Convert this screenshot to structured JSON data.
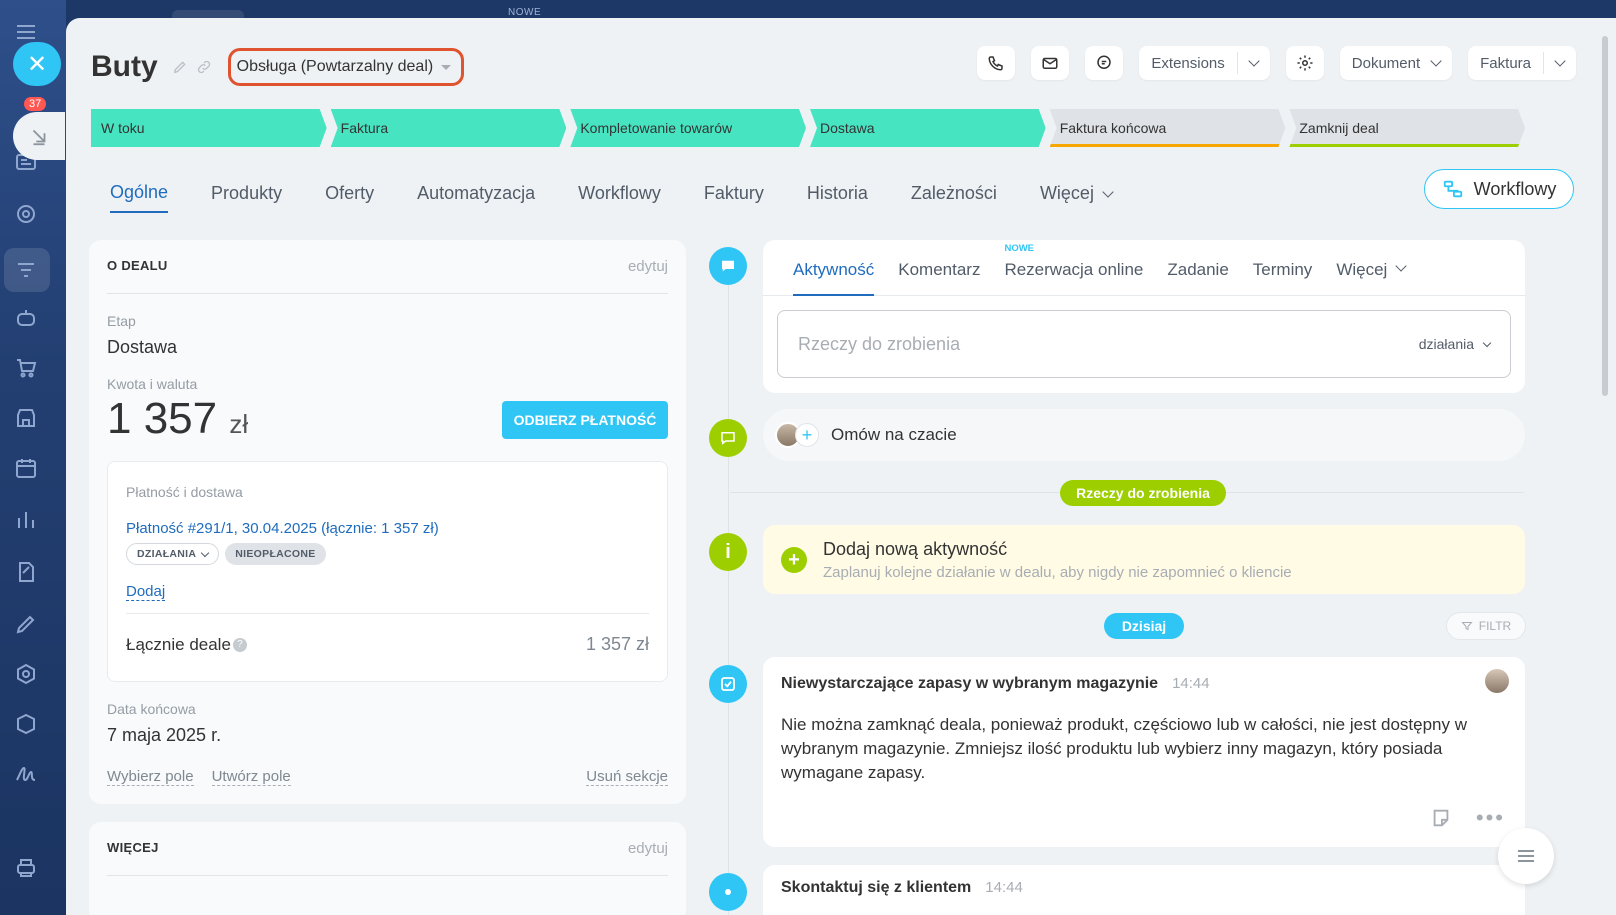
{
  "topbar": {
    "new_label": "NOWE"
  },
  "sidebar": {
    "badge_count": "37"
  },
  "deal": {
    "title": "Buty",
    "category": "Obsługa (Powtarzalny deal)"
  },
  "toolbar": {
    "extensions": "Extensions",
    "document": "Dokument",
    "invoice": "Faktura"
  },
  "stages": [
    {
      "label": "W toku",
      "state": "done"
    },
    {
      "label": "Faktura",
      "state": "done"
    },
    {
      "label": "Kompletowanie towarów",
      "state": "done"
    },
    {
      "label": "Dostawa",
      "state": "done"
    },
    {
      "label": "Faktura końcowa",
      "state": "todo"
    },
    {
      "label": "Zamknij deal",
      "state": "todo"
    }
  ],
  "tabs": [
    "Ogólne",
    "Produkty",
    "Oferty",
    "Automatyzacja",
    "Workflowy",
    "Faktury",
    "Historia",
    "Zależności",
    "Więcej"
  ],
  "workflow_button": "Workflowy",
  "about": {
    "heading": "O DEALU",
    "edit": "edytuj",
    "stage_label": "Etap",
    "stage_value": "Dostawa",
    "amount_label": "Kwota i waluta",
    "amount_value": "1 357",
    "currency": "zł",
    "pay_button": "ODBIERZ PŁATNOŚĆ",
    "payment_box": {
      "title": "Płatność i dostawa",
      "link": "Płatność #291/1, 30.04.2025 (łącznie: 1 357 zł)",
      "actions_pill": "DZIAŁANIA",
      "status_pill": "NIEOPŁACONE",
      "add": "Dodaj",
      "total_label": "Łącznie deale",
      "total_value": "1 357 zł"
    },
    "end_date_label": "Data końcowa",
    "end_date_value": "7 maja 2025 r.",
    "select_field": "Wybierz pole",
    "create_field": "Utwórz pole",
    "delete_section": "Usuń sekcje"
  },
  "more": {
    "heading": "WIĘCEJ",
    "edit": "edytuj"
  },
  "activity": {
    "tabs": [
      "Aktywność",
      "Komentarz",
      "Rezerwacja online",
      "Zadanie",
      "Terminy",
      "Więcej"
    ],
    "new_tag": "NOWE",
    "todo_placeholder": "Rzeczy do zrobienia",
    "actions": "działania",
    "chat": "Omów na czacie",
    "todo_badge": "Rzeczy do zrobienia",
    "add_title": "Dodaj nową aktywność",
    "add_sub": "Zaplanuj kolejne działanie w dealu, aby nigdy nie zapomnieć o kliencie",
    "today_badge": "Dzisiaj",
    "filter": "FILTR",
    "event": {
      "title": "Niewystarczające zapasy w wybranym magazynie",
      "time": "14:44",
      "body": "Nie można zamknąć deala, ponieważ produkt, częściowo lub w całości, nie jest dostępny w wybranym magazynie. Zmniejsz ilość produktu lub wybierz inny magazyn, który posiada wymagane zapasy."
    },
    "event2": {
      "title": "Skontaktuj się z klientem",
      "time": "14:44"
    }
  }
}
